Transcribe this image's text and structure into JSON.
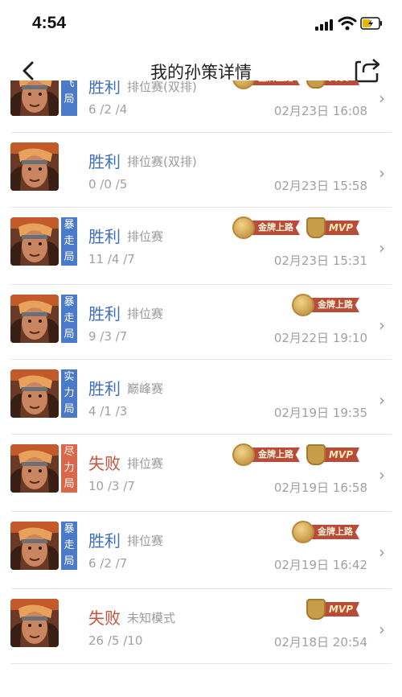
{
  "status_bar": {
    "time": "4:54"
  },
  "nav": {
    "title": "我的孙策详情"
  },
  "icons": {
    "back": "chevron-left-icon",
    "share": "share-icon",
    "row_arrow": "chevron-right-icon"
  },
  "colors": {
    "win": "#3f6fbf",
    "lose": "#c4533a",
    "tag_blue": "#4b7bc8",
    "tag_red": "#d9684b",
    "ribbon": "#b84c3a",
    "medal_gold": "#c79c4a"
  },
  "badges": {
    "gold_lane": "金牌上路",
    "mvp": "MVP"
  },
  "matches": [
    {
      "tag": [
        "飞",
        "局"
      ],
      "result": "胜利",
      "mode": "排位赛(双排)",
      "kda": "6 /2 /4",
      "datetime": "02月23日 16:08",
      "badges": [
        "gold_lane",
        "mvp"
      ]
    },
    {
      "tag": [],
      "result": "胜利",
      "mode": "排位赛(双排)",
      "kda": "0 /0 /5",
      "datetime": "02月23日 15:58",
      "badges": []
    },
    {
      "tag": [
        "暴",
        "走",
        "局"
      ],
      "result": "胜利",
      "mode": "排位赛",
      "kda": "11 /4 /7",
      "datetime": "02月23日 15:31",
      "badges": [
        "gold_lane",
        "mvp"
      ]
    },
    {
      "tag": [
        "暴",
        "走",
        "局"
      ],
      "result": "胜利",
      "mode": "排位赛",
      "kda": "9 /3 /7",
      "datetime": "02月22日 19:10",
      "badges": [
        "gold_lane"
      ]
    },
    {
      "tag": [
        "实",
        "力",
        "局"
      ],
      "result": "胜利",
      "mode": "巅峰赛",
      "kda": "4 /1 /3",
      "datetime": "02月19日 19:35",
      "badges": []
    },
    {
      "tag": [
        "尽",
        "力",
        "局"
      ],
      "result": "失败",
      "mode": "排位赛",
      "kda": "10 /3 /7",
      "datetime": "02月19日 16:58",
      "badges": [
        "gold_lane",
        "mvp"
      ]
    },
    {
      "tag": [
        "暴",
        "走",
        "局"
      ],
      "result": "胜利",
      "mode": "排位赛",
      "kda": "6 /2 /7",
      "datetime": "02月19日 16:42",
      "badges": [
        "gold_lane"
      ]
    },
    {
      "tag": [],
      "result": "失败",
      "mode": "未知模式",
      "kda": "26 /5 /10",
      "datetime": "02月18日 20:54",
      "badges": [
        "mvp"
      ]
    }
  ]
}
